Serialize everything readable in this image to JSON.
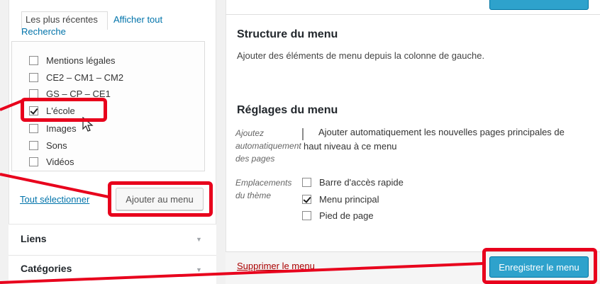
{
  "left_panel": {
    "tabs": {
      "recent": "Les plus récentes",
      "show_all": "Afficher tout",
      "search": "Recherche"
    },
    "pages": [
      {
        "label": "Mentions légales",
        "checked": false
      },
      {
        "label": "CE2 – CM1 – CM2",
        "checked": false
      },
      {
        "label": "GS – CP – CE1",
        "checked": false
      },
      {
        "label": "L'école",
        "checked": true
      },
      {
        "label": "Images",
        "checked": false
      },
      {
        "label": "Sons",
        "checked": false
      },
      {
        "label": "Vidéos",
        "checked": false
      }
    ],
    "select_all": "Tout sélectionner",
    "add_to_menu": "Ajouter au menu",
    "sections": {
      "links": "Liens",
      "categories": "Catégories"
    }
  },
  "right_panel": {
    "structure_title": "Structure du menu",
    "structure_desc": "Ajouter des éléments de menu depuis la colonne de gauche.",
    "settings_title": "Réglages du menu",
    "auto_add": {
      "label_line1": "Ajoutez",
      "label_line2": "automatiquement",
      "label_line3": "des pages",
      "option_line1": "Ajouter automatiquement les nouvelles pages principales de",
      "option_line2": "haut niveau à ce menu",
      "checked": false
    },
    "locations": {
      "label_line1": "Emplacements",
      "label_line2": "du thème",
      "options": [
        {
          "label": "Barre d'accès rapide",
          "checked": false
        },
        {
          "label": "Menu principal",
          "checked": true
        },
        {
          "label": "Pied de page",
          "checked": false
        }
      ]
    },
    "delete_menu": "Supprimer le menu",
    "save_menu": "Enregistrer le menu"
  },
  "colors": {
    "annotation_red": "#e8001c",
    "primary_blue": "#2ea2cc",
    "link_blue": "#0073aa",
    "delete_red": "#aa0000"
  }
}
